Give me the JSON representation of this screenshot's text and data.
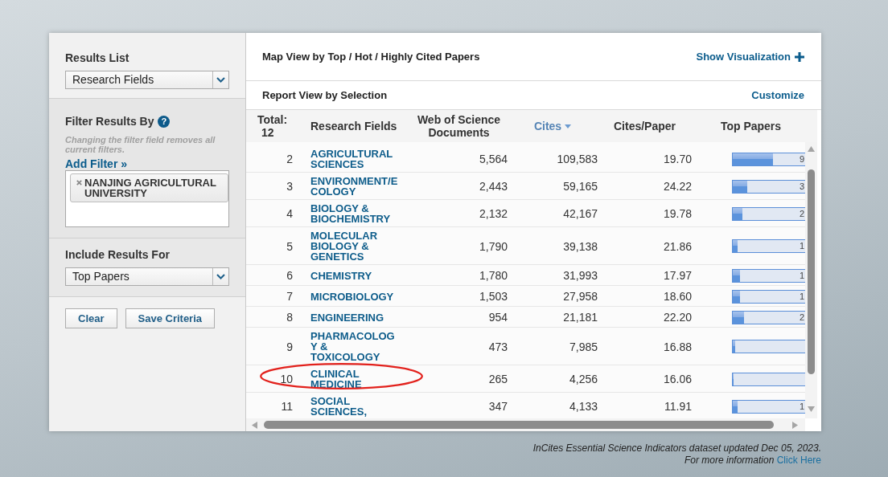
{
  "sidebar": {
    "results_list": {
      "label": "Results List",
      "value": "Research Fields"
    },
    "filter": {
      "label": "Filter Results By",
      "help": "?",
      "hint": "Changing the filter field removes all current filters.",
      "add_filter": "Add Filter »",
      "filters": [
        "NANJING AGRICULTURAL UNIVERSITY"
      ]
    },
    "include_results": {
      "label": "Include Results For",
      "value": "Top Papers"
    },
    "buttons": [
      "Clear",
      "Save Criteria"
    ]
  },
  "report": {
    "map_view": {
      "title": "Map View by Top / Hot / Highly Cited Papers",
      "action": "Show Visualization"
    },
    "report_view": {
      "title": "Report View by Selection",
      "action": "Customize"
    },
    "table": {
      "total_label": "Total:",
      "total": "12",
      "columns": [
        {
          "label": "Research Fields",
          "sorted": false
        },
        {
          "label": "Web of Science Documents",
          "sorted": false
        },
        {
          "label": "Cites",
          "sorted": true
        },
        {
          "label": "Cites/Paper",
          "sorted": false
        },
        {
          "label": "Top Papers",
          "sorted": false
        }
      ],
      "rows": [
        {
          "rank": "2",
          "field": "AGRICULTURAL SCIENCES",
          "documents": "5,564",
          "cites": "109,583",
          "cites_per_paper": "19.70",
          "top_papers": "9",
          "level": 0.55,
          "circled": false
        },
        {
          "rank": "3",
          "field": "ENVIRONMENT/ECOLOGY",
          "documents": "2,443",
          "cites": "59,165",
          "cites_per_paper": "24.22",
          "top_papers": "3",
          "level": 0.2,
          "circled": false
        },
        {
          "rank": "4",
          "field": "BIOLOGY & BIOCHEMISTRY",
          "documents": "2,132",
          "cites": "42,167",
          "cites_per_paper": "19.78",
          "top_papers": "2",
          "level": 0.13,
          "circled": false
        },
        {
          "rank": "5",
          "field": "MOLECULAR BIOLOGY & GENETICS",
          "documents": "1,790",
          "cites": "39,138",
          "cites_per_paper": "21.86",
          "top_papers": "1",
          "level": 0.07,
          "circled": false
        },
        {
          "rank": "6",
          "field": "CHEMISTRY",
          "documents": "1,780",
          "cites": "31,993",
          "cites_per_paper": "17.97",
          "top_papers": "1",
          "level": 0.1,
          "circled": false
        },
        {
          "rank": "7",
          "field": "MICROBIOLOGY",
          "documents": "1,503",
          "cites": "27,958",
          "cites_per_paper": "18.60",
          "top_papers": "1",
          "level": 0.1,
          "circled": false
        },
        {
          "rank": "8",
          "field": "ENGINEERING",
          "documents": "954",
          "cites": "21,181",
          "cites_per_paper": "22.20",
          "top_papers": "2",
          "level": 0.15,
          "circled": false
        },
        {
          "rank": "9",
          "field": "PHARMACOLOGY & TOXICOLOGY",
          "documents": "473",
          "cites": "7,985",
          "cites_per_paper": "16.88",
          "level": 0.03,
          "circled": false
        },
        {
          "rank": "10",
          "field": "CLINICAL MEDICINE",
          "documents": "265",
          "cites": "4,256",
          "cites_per_paper": "16.06",
          "level": 0.01,
          "circled": true
        },
        {
          "rank": "11",
          "field": "SOCIAL SCIENCES,",
          "documents": "347",
          "cites": "4,133",
          "cites_per_paper": "11.91",
          "top_papers": "1",
          "level": 0.07,
          "circled": false
        }
      ]
    }
  },
  "footer": {
    "note": "InCites Essential Science Indicators dataset updated Dec 05, 2023.",
    "more_info": "For more information",
    "link": "Click Here"
  }
}
